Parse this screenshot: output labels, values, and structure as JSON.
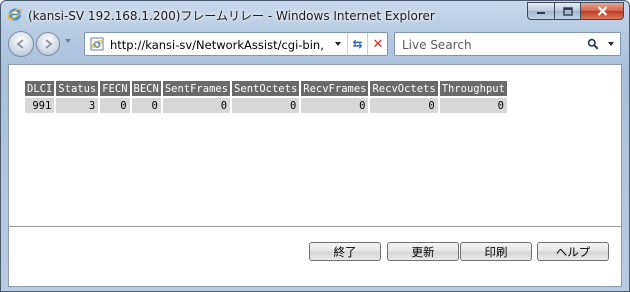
{
  "window": {
    "title": "(kansi-SV 192.168.1.200)フレームリレー - Windows Internet Explorer"
  },
  "navbar": {
    "address": "http://kansi-sv/NetworkAssist/cgi-bin,",
    "search_placeholder": "Live Search"
  },
  "table": {
    "headers": [
      "DLCI",
      "Status",
      "FECN",
      "BECN",
      "SentFrames",
      "SentOctets",
      "RecvFrames",
      "RecvOctets",
      "Throughput"
    ],
    "rows": [
      [
        "991",
        "3",
        "0",
        "0",
        "0",
        "0",
        "0",
        "0",
        "0"
      ]
    ]
  },
  "buttons": {
    "end": "終了",
    "refresh": "更新",
    "print": "印刷",
    "help": "ヘルプ"
  },
  "colors": {
    "header_bg": "#6a6a6a",
    "cell_bg": "#d7d7d7",
    "chrome_bg": "#b7cbe2"
  }
}
